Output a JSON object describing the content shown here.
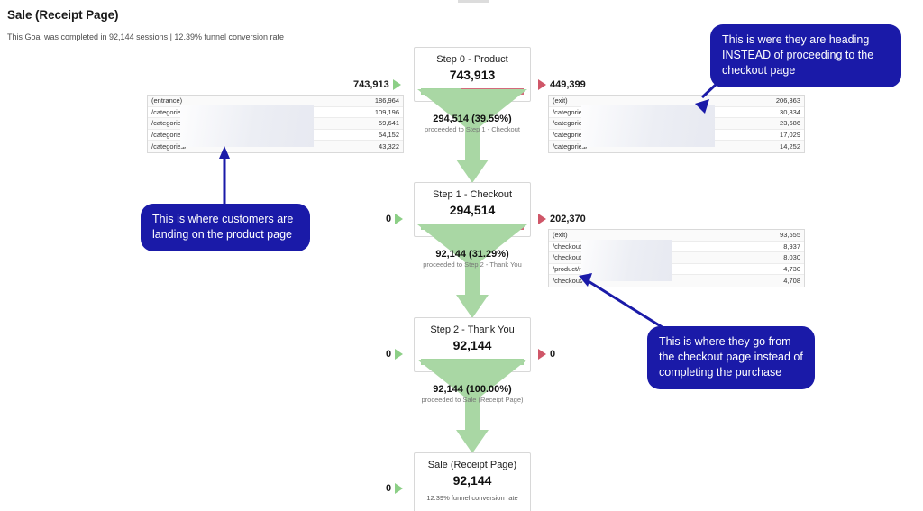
{
  "header": {
    "title": "Sale (Receipt Page)",
    "subtitle": "This Goal was completed in 92,144 sessions | 12.39% funnel conversion rate"
  },
  "chart_data": {
    "type": "funnel",
    "title": "Sale (Receipt Page)",
    "total_sessions": "92,144",
    "conversion_rate": "12.39%",
    "steps": [
      {
        "name": "Step 0 - Product",
        "count": "743,913",
        "entered_value": "743,913",
        "exited_value": "449,399",
        "proceeded_count": "294,514",
        "proceeded_pct": "39.59%",
        "proceeded_label": "294,514 (39.59%)",
        "proceeded_sub": "proceeded to Step 1 - Checkout",
        "green_pct": 39.59,
        "red_pct": 60.41
      },
      {
        "name": "Step 1 - Checkout",
        "count": "294,514",
        "entered_value": "0",
        "exited_value": "202,370",
        "proceeded_count": "92,144",
        "proceeded_pct": "31.29%",
        "proceeded_label": "92,144 (31.29%)",
        "proceeded_sub": "proceeded to Step 2 - Thank You",
        "green_pct": 31.29,
        "red_pct": 68.71
      },
      {
        "name": "Step 2 - Thank You",
        "count": "92,144",
        "entered_value": "0",
        "exited_value": "0",
        "proceeded_count": "92,144",
        "proceeded_pct": "100.00%",
        "proceeded_label": "92,144 (100.00%)",
        "proceeded_sub": "proceeded to Sale (Receipt Page)",
        "green_pct": 100,
        "red_pct": 0
      },
      {
        "name": "Sale (Receipt Page)",
        "count": "92,144",
        "entered_value": "0",
        "note": "12.39% funnel conversion rate"
      }
    ]
  },
  "tables": {
    "step0_entrance": {
      "total": "743,913",
      "rows": [
        {
          "label": "(entrance)",
          "value": "186,964"
        },
        {
          "label": "/categories/",
          "value": "109,196"
        },
        {
          "label": "/categories/",
          "value": "59,641"
        },
        {
          "label": "/categories/",
          "value": "54,152"
        },
        {
          "label": "/categories/",
          "value": "43,322"
        }
      ]
    },
    "step0_exit": {
      "total": "449,399",
      "rows": [
        {
          "label": "(exit)",
          "value": "206,363"
        },
        {
          "label": "/categories/",
          "value": "30,834"
        },
        {
          "label": "/categories/",
          "value": "23,686"
        },
        {
          "label": "/categories/",
          "value": "17,029"
        },
        {
          "label": "/categories/",
          "value": "14,252"
        }
      ]
    },
    "step1_exit": {
      "total": "202,370",
      "rows": [
        {
          "label": "(exit)",
          "value": "93,555"
        },
        {
          "label": "/checkout/",
          "value": "8,937"
        },
        {
          "label": "/checkout/",
          "value": "8,030"
        },
        {
          "label": "/product/re",
          "value": "4,730"
        },
        {
          "label": "/checkout/",
          "value": "4,708"
        }
      ]
    }
  },
  "annotations": [
    {
      "id": "product-landing",
      "text": "This is where customers are landing on the product page"
    },
    {
      "id": "exit-instead-of-checkout",
      "text": "This is were they are heading INSTEAD of proceeding to the checkout page"
    },
    {
      "id": "checkout-abandon",
      "text": "This is where they go from the checkout page instead of completing the purchase"
    }
  ],
  "colors": {
    "green": "#a5d6a0",
    "red": "#d4697b",
    "annotation": "#1a1aa8",
    "marker_green": "#8ccf86",
    "marker_red": "#cf5668"
  }
}
